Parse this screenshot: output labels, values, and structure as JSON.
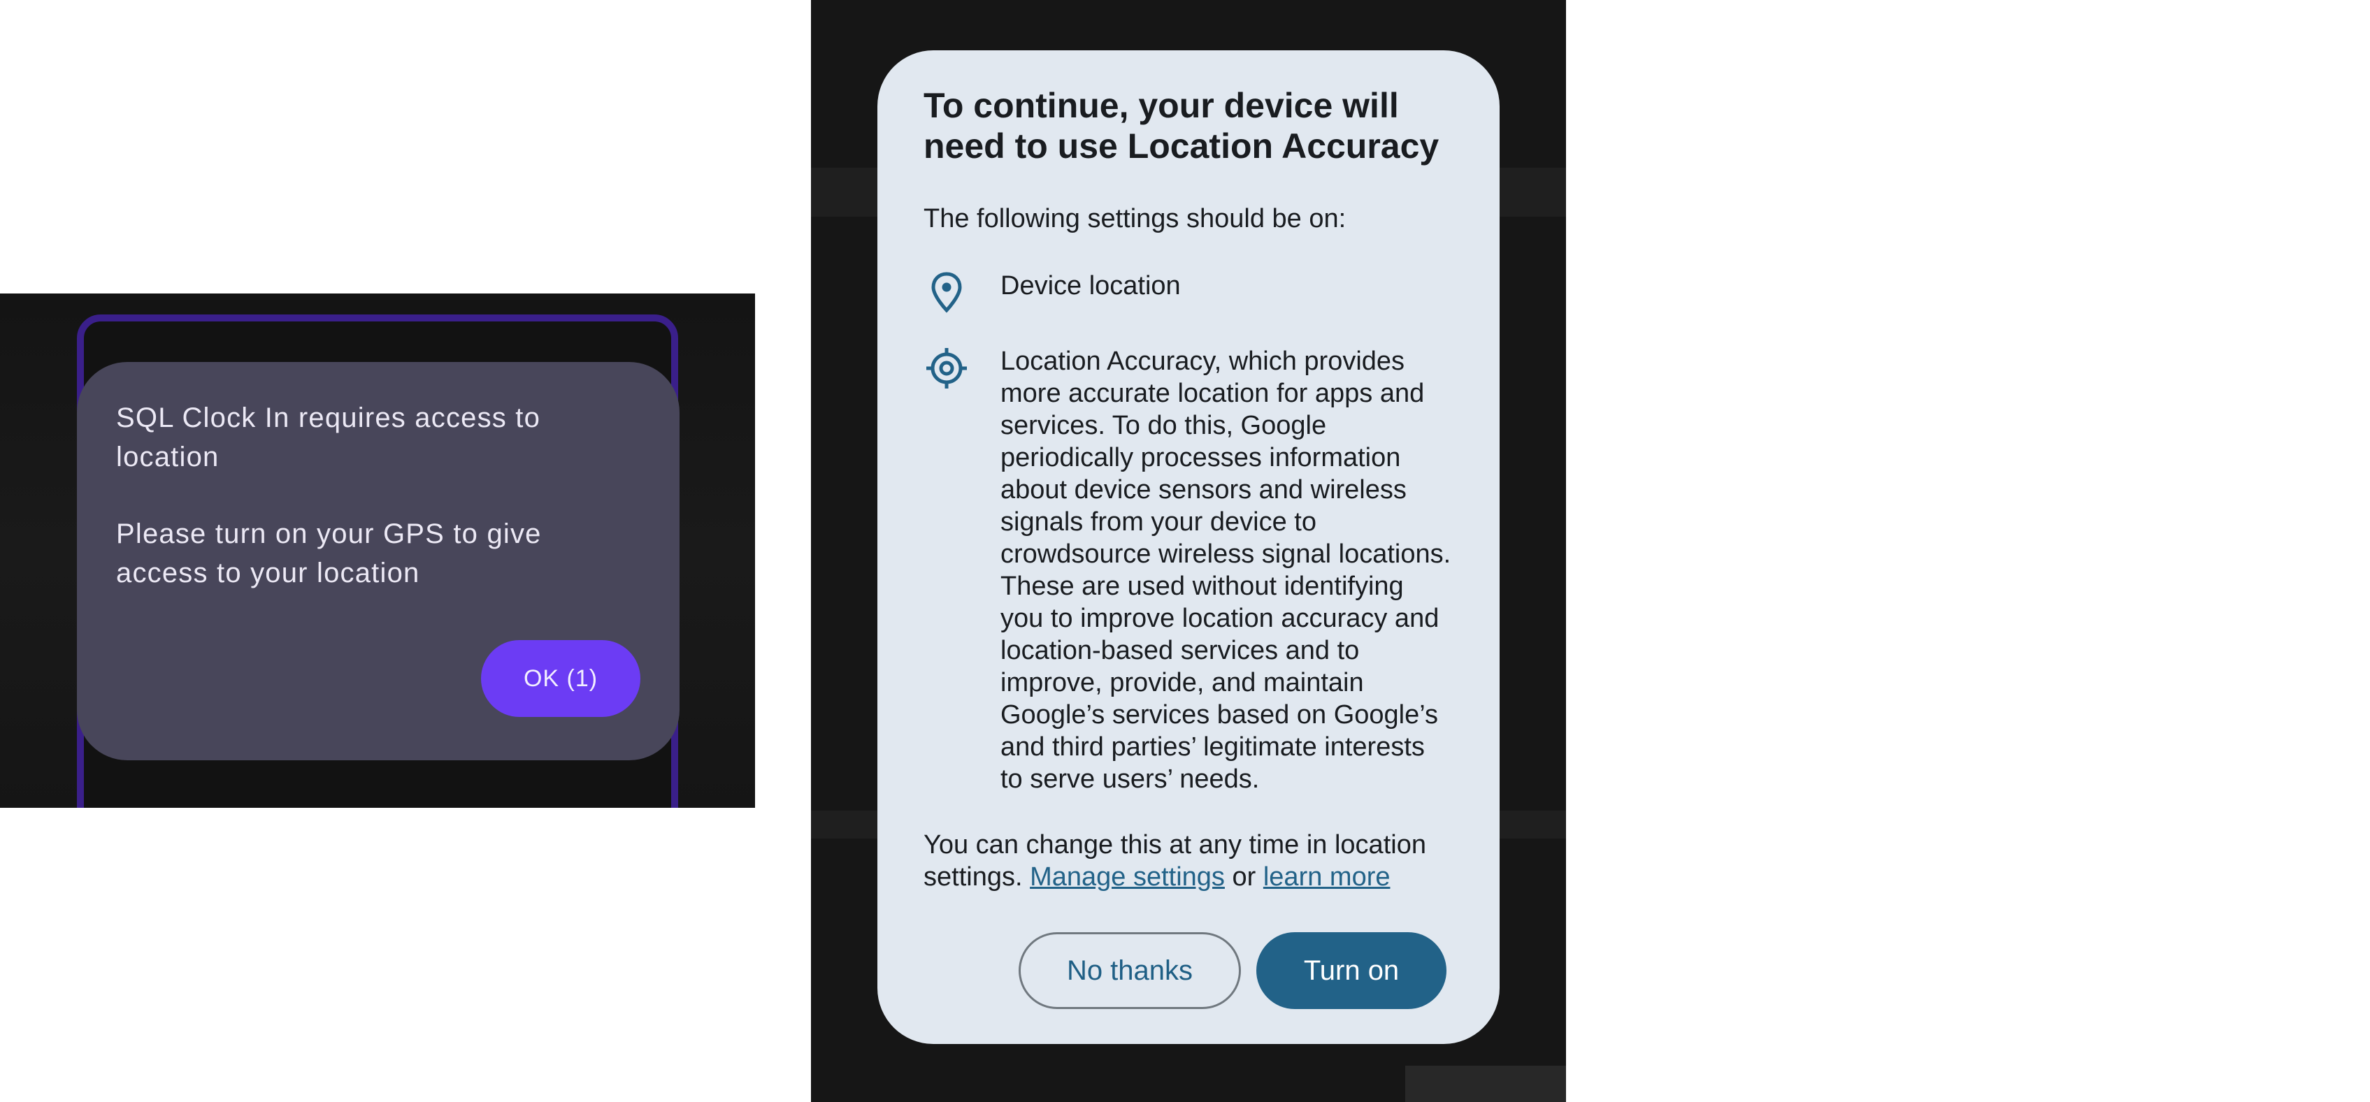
{
  "left_dialog": {
    "title": "SQL Clock In requires access to location",
    "message": "Please turn on your GPS to give access to your location",
    "ok_button": "OK (1)",
    "accent_color": "#6c3cf4",
    "dialog_color": "#48465a"
  },
  "location_dialog": {
    "title": "To continue, your device will need to use Location Accuracy",
    "subtitle": "The following settings should be on:",
    "settings": [
      {
        "icon": "location-pin-icon",
        "label": "Device location"
      },
      {
        "icon": "crosshair-icon",
        "label": "Location Accuracy, which provides more accurate location for apps and services. To do this, Google periodically processes information about device sensors and wireless signals from your device to crowdsource wireless signal locations. These are used without identifying you to improve location accuracy and location-based services and to improve, provide, and maintain Google’s services based on Google’s and third parties’ legitimate interests to serve users’ needs."
      }
    ],
    "footer": {
      "text": "You can change this at any time in location settings.",
      "manage_link": "Manage settings",
      "conjunction": "or",
      "learn_link": "learn more"
    },
    "buttons": {
      "no_thanks": "No thanks",
      "turn_on": "Turn on"
    },
    "accent_color": "#226288",
    "dialog_color": "#e1e8f0"
  }
}
